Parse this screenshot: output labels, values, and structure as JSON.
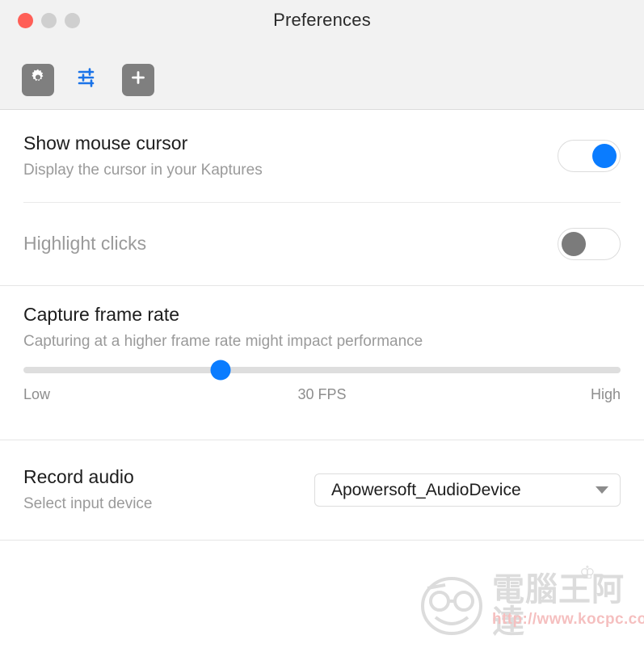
{
  "window": {
    "title": "Preferences",
    "traffic_lights": [
      "close",
      "minimize",
      "zoom"
    ],
    "accent_color": "#0a7cff",
    "toolbar_bg": "#f2f2f2"
  },
  "toolbar": {
    "items": [
      {
        "name": "general-tab",
        "icon": "gear-icon",
        "selected": false,
        "style": "filled"
      },
      {
        "name": "recording-tab",
        "icon": "sliders-icon",
        "selected": true,
        "style": "plain"
      },
      {
        "name": "add-tab",
        "icon": "plus-icon",
        "selected": false,
        "style": "filled"
      }
    ]
  },
  "settings": {
    "show_mouse_cursor": {
      "title": "Show mouse cursor",
      "subtitle": "Display the cursor in your Kaptures",
      "toggle_state": "on"
    },
    "highlight_clicks": {
      "title": "Highlight clicks",
      "subtitle": "",
      "toggle_state": "off",
      "disabled": true
    },
    "capture_frame_rate": {
      "title": "Capture frame rate",
      "subtitle": "Capturing at a higher frame rate might impact performance",
      "slider": {
        "value_label": "30 FPS",
        "min_label": "Low",
        "max_label": "High",
        "percent": 33
      }
    },
    "record_audio": {
      "title": "Record audio",
      "subtitle": "Select input device",
      "dropdown": {
        "selected": "Apowersoft_AudioDevice",
        "icon": "chevron-down-icon"
      }
    }
  },
  "watermark": {
    "brand": "電腦王阿達",
    "url": "http://www.kocpc.com.tw"
  }
}
